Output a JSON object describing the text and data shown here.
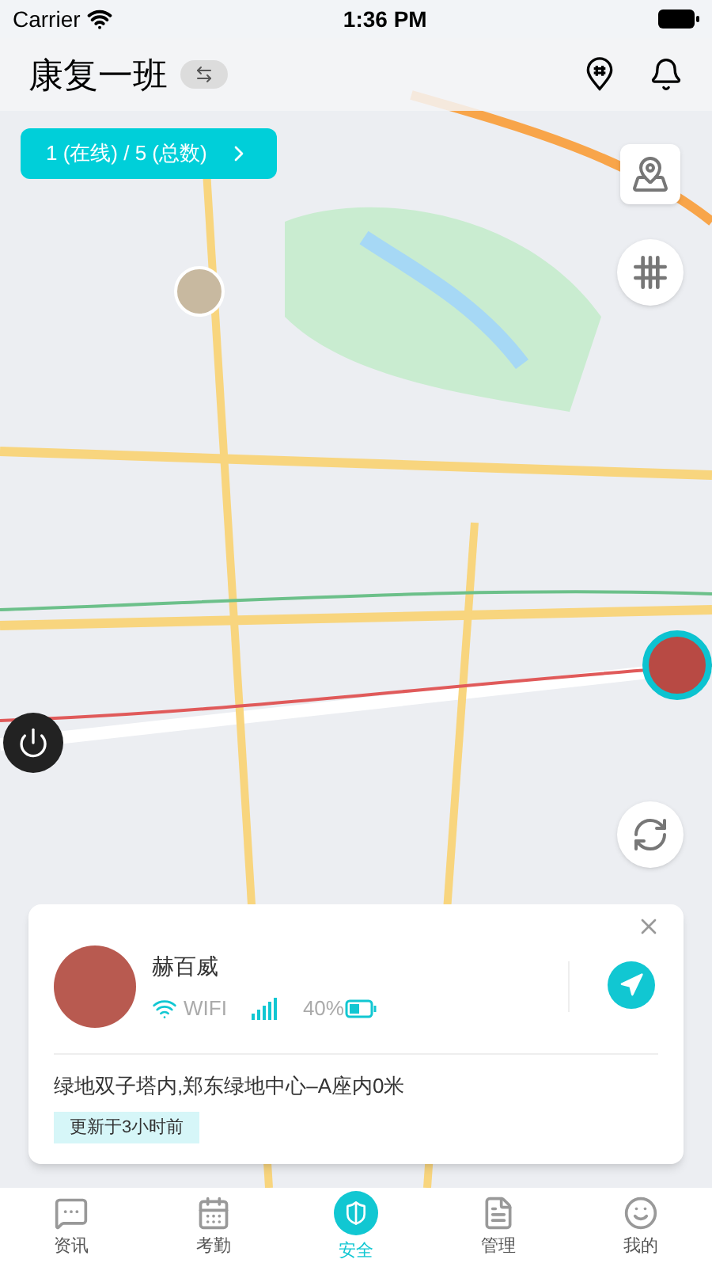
{
  "status_bar": {
    "carrier": "Carrier",
    "time": "1:36 PM"
  },
  "header": {
    "title": "康复一班"
  },
  "member_count": {
    "label": "1 (在线) / 5 (总数)"
  },
  "member_card": {
    "name": "赫百威",
    "network": "WIFI",
    "battery": "40%",
    "address": "绿地双子塔内,郑东绿地中心–A座内0米",
    "updated": "更新于3小时前"
  },
  "tabs": [
    {
      "label": "资讯",
      "selected": false
    },
    {
      "label": "考勤",
      "selected": false
    },
    {
      "label": "安全",
      "selected": true
    },
    {
      "label": "管理",
      "selected": false
    },
    {
      "label": "我的",
      "selected": false
    }
  ]
}
